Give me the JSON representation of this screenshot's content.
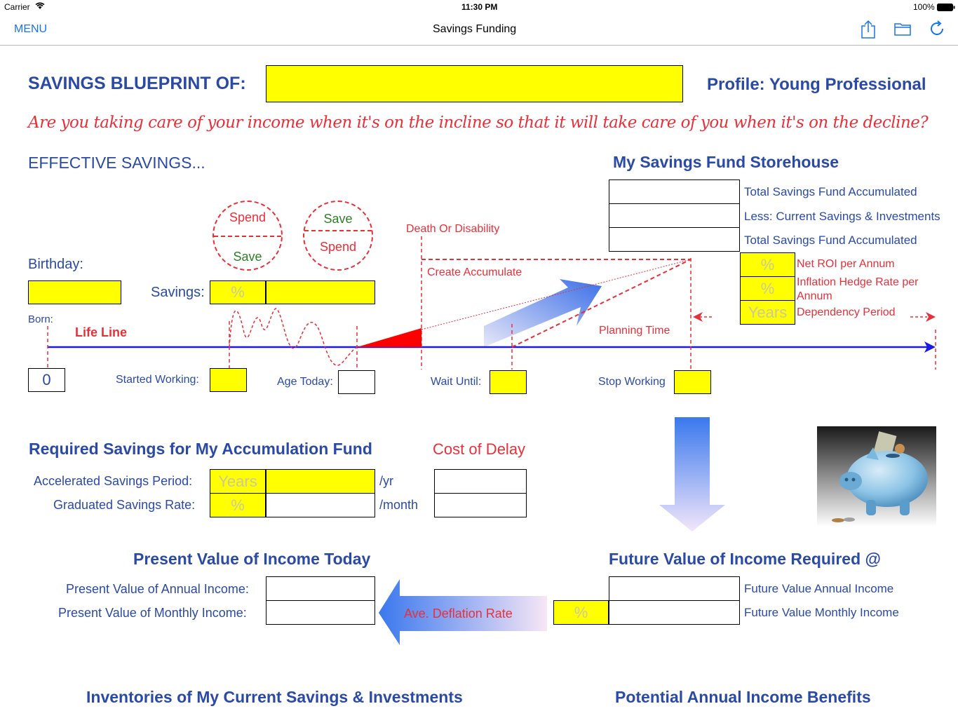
{
  "status": {
    "carrier": "Carrier",
    "time": "11:30 PM",
    "battery": "100%"
  },
  "nav": {
    "menu": "MENU",
    "title": "Savings Funding"
  },
  "header": {
    "blueprint_label": "SAVINGS BLUEPRINT OF:",
    "profile": "Profile: Young Professional",
    "tagline": "Are you taking care of your income when it's on the incline so that it will take care of you when it's on the decline?"
  },
  "effective": {
    "title": "EFFECTIVE SAVINGS...",
    "circle1": {
      "top": "Spend",
      "bottom": "Save"
    },
    "circle2": {
      "top": "Save",
      "bottom": "Spend"
    },
    "birthday_label": "Birthday:",
    "savings_label": "Savings:",
    "savings_pct": "%",
    "born_label": "Born:",
    "born_value": "0",
    "life_line": "Life Line",
    "started_working": "Started Working:",
    "age_today": "Age Today:",
    "death_or_disability": "Death Or  Disability",
    "create_accumulate": "Create Accumulate",
    "planning_time": "Planning Time",
    "wait_until": "Wait Until:",
    "stop_working": "Stop Working"
  },
  "storehouse": {
    "title": "My Savings Fund Storehouse",
    "rows": [
      "Total Savings Fund Accumulated",
      "Less: Current Savings & Investments",
      "Total Savings Fund Accumulated"
    ],
    "rates": [
      {
        "unit": "%",
        "label": "Net ROI per Annum"
      },
      {
        "unit": "%",
        "label": "Inflation Hedge Rate  per Annum"
      },
      {
        "unit": "Years",
        "label": "Dependency Period"
      }
    ]
  },
  "required": {
    "title": "Required Savings for My Accumulation Fund",
    "cost_of_delay": "Cost of Delay",
    "rows": [
      {
        "label": "Accelerated Savings Period:",
        "unit": "Years",
        "suffix": "/yr"
      },
      {
        "label": "Graduated Savings Rate:",
        "unit": "%",
        "suffix": "/month"
      }
    ]
  },
  "present": {
    "title": "Present Value of Income Today",
    "annual": "Present Value of Annual Income:",
    "monthly": "Present Value of Monthly Income:",
    "deflation": "Ave. Deflation Rate"
  },
  "future": {
    "title": "Future Value of Income Required @",
    "annual": "Future Value Annual Income",
    "monthly": "Future Value Monthly Income",
    "pct": "%"
  },
  "bottom": {
    "inventories": "Inventories of My Current Savings & Investments",
    "benefits": "Potential Annual Income Benefits"
  },
  "colors": {
    "accent": "#2a4aa6",
    "link": "#1a73e8",
    "alert": "#e8303a",
    "input": "#ffff00"
  }
}
